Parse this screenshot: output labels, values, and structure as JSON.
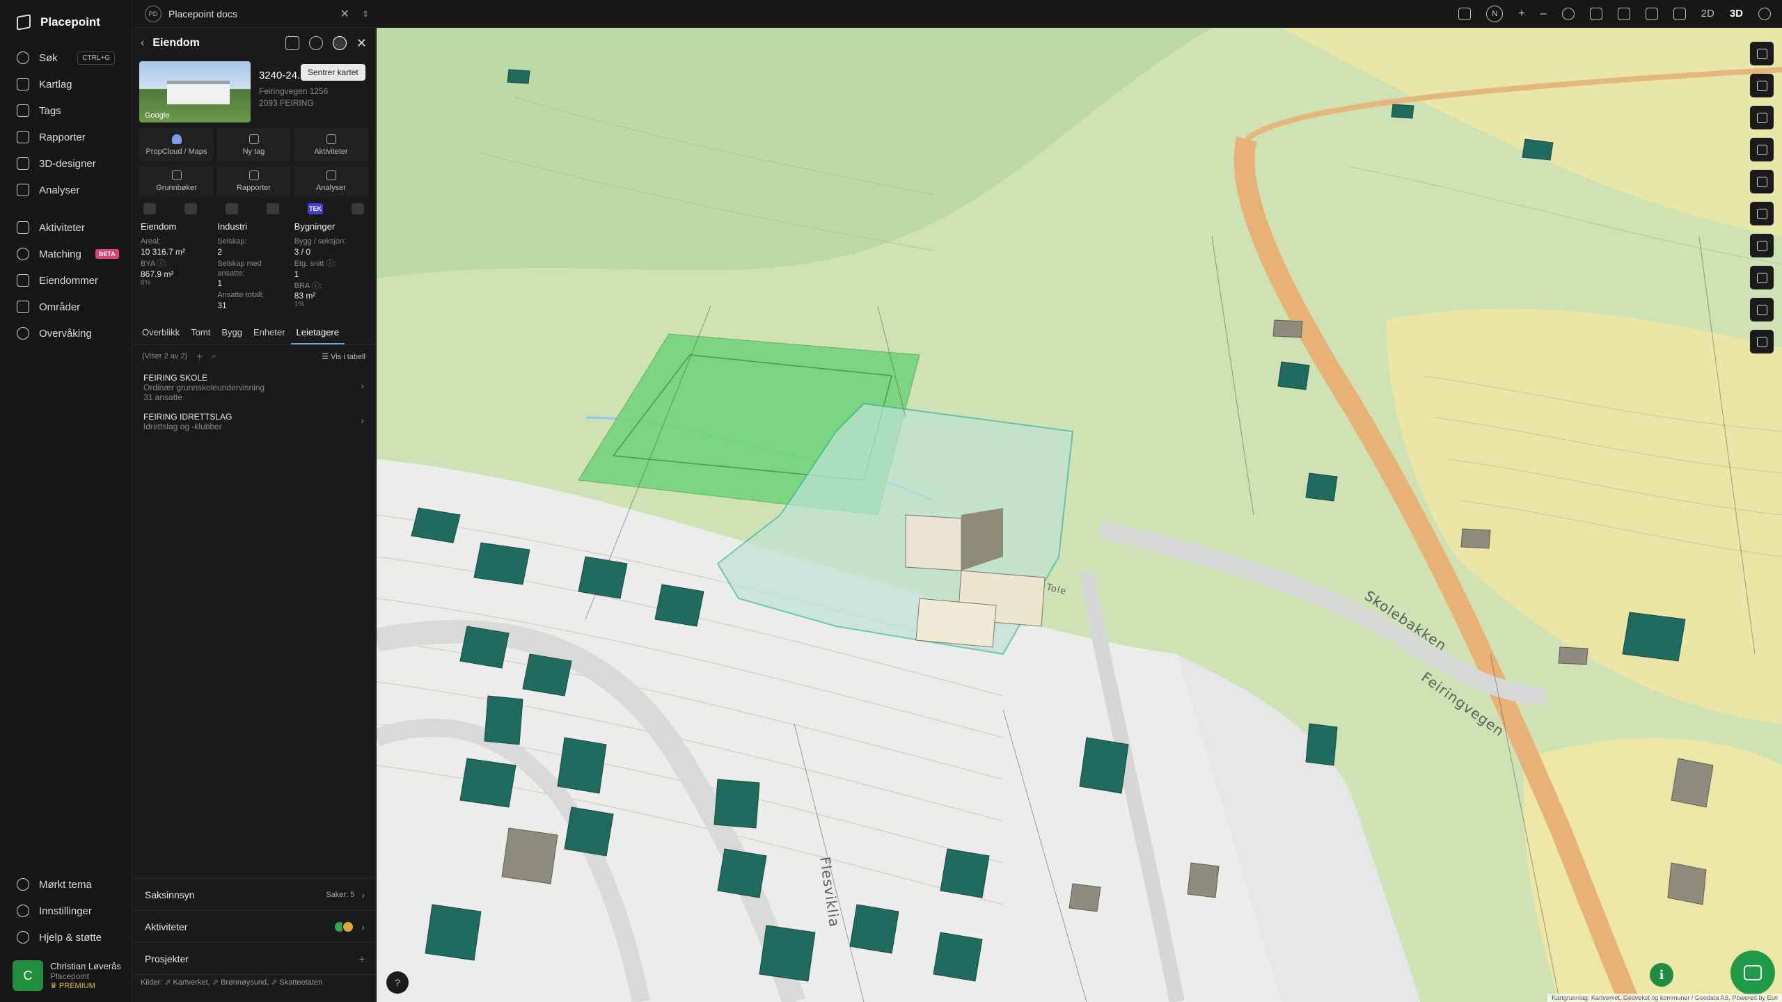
{
  "app": {
    "name": "Placepoint"
  },
  "nav": {
    "search": {
      "label": "Søk",
      "shortcut": "CTRL+G"
    },
    "items": [
      {
        "label": "Kartlag"
      },
      {
        "label": "Tags"
      },
      {
        "label": "Rapporter"
      },
      {
        "label": "3D-designer"
      },
      {
        "label": "Analyser"
      }
    ],
    "items2": [
      {
        "label": "Aktiviteter"
      },
      {
        "label": "Matching",
        "badge": "BETA"
      },
      {
        "label": "Eiendommer"
      },
      {
        "label": "Områder"
      },
      {
        "label": "Overvåking"
      }
    ],
    "bottom": [
      {
        "label": "Mørkt tema"
      },
      {
        "label": "Innstillinger"
      },
      {
        "label": "Hjelp & støtte"
      }
    ],
    "user": {
      "initial": "C",
      "name": "Christian Løverås",
      "org": "Placepoint",
      "plan": "PREMIUM"
    }
  },
  "topbar": {
    "docs_badge": "PD",
    "docs_title": "Placepoint docs",
    "compass": "N",
    "mode_2d": "2D",
    "mode_3d": "3D",
    "zoom_in": "+",
    "zoom_out": "–"
  },
  "panel": {
    "title": "Eiendom",
    "tooltip": "Sentrer kartet",
    "property_id": "3240-24...",
    "address": "Feiringvegen 1256",
    "postal": "2093 FEIRING",
    "photo_credit": "Google",
    "actions": [
      {
        "label": "PropCloud / Maps"
      },
      {
        "label": "Ny tag"
      },
      {
        "label": "Aktiviteter"
      },
      {
        "label": "Grunnbøker"
      },
      {
        "label": "Rapporter"
      },
      {
        "label": "Analyser"
      }
    ],
    "tek_label": "TEK",
    "stats": {
      "eiendom": {
        "head": "Eiendom",
        "areal_label": "Areal:",
        "areal_value": "10 316.7 m²",
        "bya_label": "BYA ⓘ:",
        "bya_value": "867.9 m²",
        "bya_pct": "8%"
      },
      "industri": {
        "head": "Industri",
        "selskap_label": "Selskap:",
        "selskap_value": "2",
        "ansatte_label": "Selskap med ansatte:",
        "ansatte_value": "1",
        "totalt_label": "Ansatte totalt:",
        "totalt_value": "31"
      },
      "bygninger": {
        "head": "Bygninger",
        "seksjon_label": "Bygg / seksjon:",
        "seksjon_value": "3 / 0",
        "etg_label": "Etg. snitt ⓘ:",
        "etg_value": "1",
        "bra_label": "BRA ⓘ:",
        "bra_value": "83 m²",
        "bra_pct": "1%"
      }
    },
    "tabs": [
      {
        "label": "Overblikk"
      },
      {
        "label": "Tomt"
      },
      {
        "label": "Bygg"
      },
      {
        "label": "Enheter"
      },
      {
        "label": "Leietagere"
      }
    ],
    "list_count": "(Viser 2 av 2)",
    "list_toggle": "Vis i tabell",
    "tenants": [
      {
        "name": "FEIRING SKOLE",
        "category": "Ordinær grunnskoleundervisning",
        "employees": "31 ansatte"
      },
      {
        "name": "FEIRING IDRETTSLAG",
        "category": "Idrettslag og -klubber"
      }
    ],
    "sections": {
      "saksinnsyn": {
        "label": "Saksinnsyn",
        "meta_label": "Saker:",
        "meta_value": "5"
      },
      "aktiviteter": {
        "label": "Aktiviteter"
      },
      "prosjekter": {
        "label": "Prosjekter",
        "action": "+"
      }
    },
    "sources": "Kilder: ⬀ Kartverket, ⬀ Brønnøysund, ⬀ Skatteetaten"
  },
  "map": {
    "labels": [
      {
        "text": "Skolebakken"
      },
      {
        "text": "Feiringvegen"
      },
      {
        "text": "Flesviklia"
      },
      {
        "text": "Tole"
      }
    ],
    "attribution": "Kartgrunnlag: Kartverket, Geovekst og kommuner / Geodata AS, Powered by Esri",
    "help": "?",
    "info": "i"
  },
  "colors": {
    "accent": "#5aa9e6",
    "brand_green": "#1f9a48",
    "beta": "#e0407a"
  }
}
